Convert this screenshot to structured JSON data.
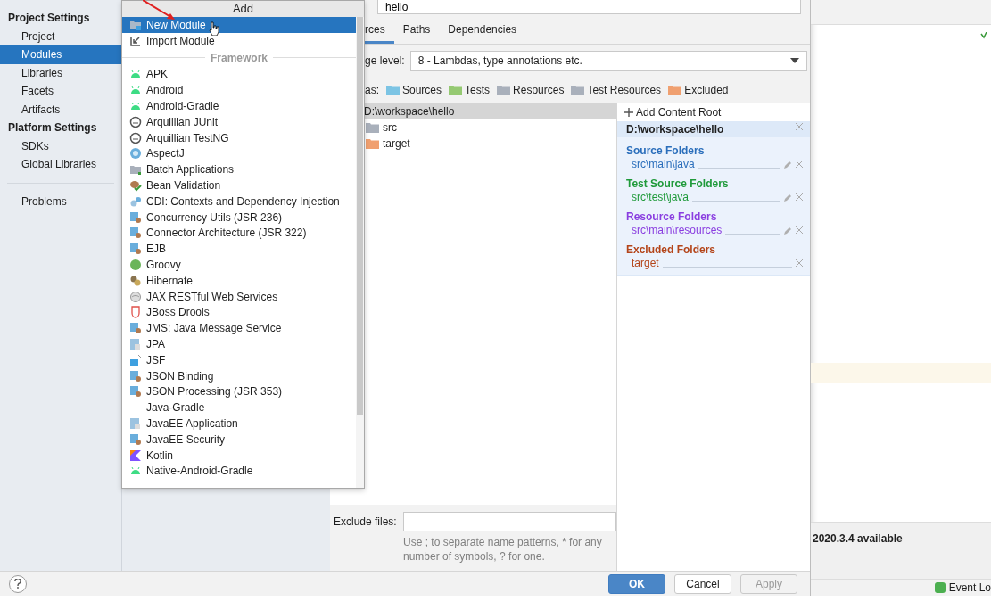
{
  "sidebar": {
    "groups": [
      {
        "title": "Project Settings",
        "items": [
          {
            "label": "Project",
            "selected": false
          },
          {
            "label": "Modules",
            "selected": true
          },
          {
            "label": "Libraries",
            "selected": false
          },
          {
            "label": "Facets",
            "selected": false
          },
          {
            "label": "Artifacts",
            "selected": false
          }
        ]
      },
      {
        "title": "Platform Settings",
        "items": [
          {
            "label": "SDKs",
            "selected": false
          },
          {
            "label": "Global Libraries",
            "selected": false
          }
        ]
      }
    ],
    "extra_items": [
      {
        "label": "Problems",
        "selected": false
      }
    ]
  },
  "popup": {
    "title": "Add",
    "items": [
      {
        "label": "New Module",
        "kind": "module",
        "selected": true
      },
      {
        "label": "Import Module",
        "kind": "import",
        "selected": false
      }
    ],
    "group_label": "Framework",
    "group_items": [
      {
        "label": "APK",
        "kind": "android",
        "selected": false
      },
      {
        "label": "Android",
        "kind": "android",
        "selected": false
      },
      {
        "label": "Android-Gradle",
        "kind": "android",
        "selected": false
      },
      {
        "label": "Arquillian JUnit",
        "kind": "ring",
        "selected": false
      },
      {
        "label": "Arquillian TestNG",
        "kind": "ring",
        "selected": false
      },
      {
        "label": "AspectJ",
        "kind": "aspect",
        "selected": false
      },
      {
        "label": "Batch Applications",
        "kind": "folder",
        "selected": false
      },
      {
        "label": "Bean Validation",
        "kind": "bean",
        "selected": false
      },
      {
        "label": "CDI: Contexts and Dependency Injection",
        "kind": "cdi",
        "selected": false
      },
      {
        "label": "Concurrency Utils (JSR 236)",
        "kind": "plugin",
        "selected": false
      },
      {
        "label": "Connector Architecture (JSR 322)",
        "kind": "plugin",
        "selected": false
      },
      {
        "label": "EJB",
        "kind": "plugin",
        "selected": false
      },
      {
        "label": "Groovy",
        "kind": "groovy",
        "selected": false
      },
      {
        "label": "Hibernate",
        "kind": "hibernate",
        "selected": false
      },
      {
        "label": "JAX RESTful Web Services",
        "kind": "globe",
        "selected": false
      },
      {
        "label": "JBoss Drools",
        "kind": "drools",
        "selected": false
      },
      {
        "label": "JMS: Java Message Service",
        "kind": "plugin",
        "selected": false
      },
      {
        "label": "JPA",
        "kind": "sheet",
        "selected": false
      },
      {
        "label": "JSF",
        "kind": "jsf",
        "selected": false
      },
      {
        "label": "JSON Binding",
        "kind": "plugin",
        "selected": false
      },
      {
        "label": "JSON Processing (JSR 353)",
        "kind": "plugin",
        "selected": false
      },
      {
        "label": "Java-Gradle",
        "kind": "none",
        "selected": false
      },
      {
        "label": "JavaEE Application",
        "kind": "sheet",
        "selected": false
      },
      {
        "label": "JavaEE Security",
        "kind": "plugin",
        "selected": false
      },
      {
        "label": "Kotlin",
        "kind": "kotlin",
        "selected": false
      },
      {
        "label": "Native-Android-Gradle",
        "kind": "android",
        "selected": false
      }
    ]
  },
  "module": {
    "name": "hello",
    "tabs": [
      {
        "label": "rces",
        "selected": true
      },
      {
        "label": "Paths",
        "selected": false
      },
      {
        "label": "Dependencies",
        "selected": false
      }
    ],
    "language_level": {
      "label": "ge level:",
      "value": "8 - Lambdas, type annotations etc."
    },
    "mark_as": {
      "label": "as:",
      "items": [
        {
          "label": "Sources",
          "color": "#7cc4e4"
        },
        {
          "label": "Tests",
          "color": "#95c972"
        },
        {
          "label": "Resources",
          "color": "#a9b0bb"
        },
        {
          "label": "Test Resources",
          "color": "#a9b0bb"
        },
        {
          "label": "Excluded",
          "color": "#f0a070"
        }
      ]
    },
    "tree": [
      {
        "label": "D:\\workspace\\hello",
        "selected": true,
        "children": [
          {
            "label": "src",
            "color": "#a9b0bb",
            "selected": false
          },
          {
            "label": "target",
            "color": "#f0a070",
            "selected": false
          }
        ]
      }
    ],
    "exclude_files": {
      "label": "Exclude files:",
      "hint": "Use ; to separate name patterns, * for any number of symbols, ? for one."
    },
    "content_roots": {
      "add_label": "Add Content Root",
      "root": "D:\\workspace\\hello",
      "sections": [
        {
          "title": "Source Folders",
          "color": "#2a6ebb",
          "folders": [
            "src\\main\\java"
          ],
          "editable": true
        },
        {
          "title": "Test Source Folders",
          "color": "#1f9a3a",
          "folders": [
            "src\\test\\java"
          ],
          "editable": true
        },
        {
          "title": "Resource Folders",
          "color": "#8a3ee0",
          "folders": [
            "src\\main\\resources"
          ],
          "editable": true
        },
        {
          "title": "Excluded Folders",
          "color": "#b4451a",
          "folders": [
            "target"
          ],
          "editable": false
        }
      ]
    }
  },
  "footer": {
    "buttons": [
      {
        "label": "OK",
        "primary": true,
        "disabled": false
      },
      {
        "label": "Cancel",
        "primary": false,
        "disabled": false
      },
      {
        "label": "Apply",
        "primary": false,
        "disabled": true
      }
    ]
  },
  "ide": {
    "notification": "2020.3.4 available",
    "event_log": "Event Lo"
  }
}
